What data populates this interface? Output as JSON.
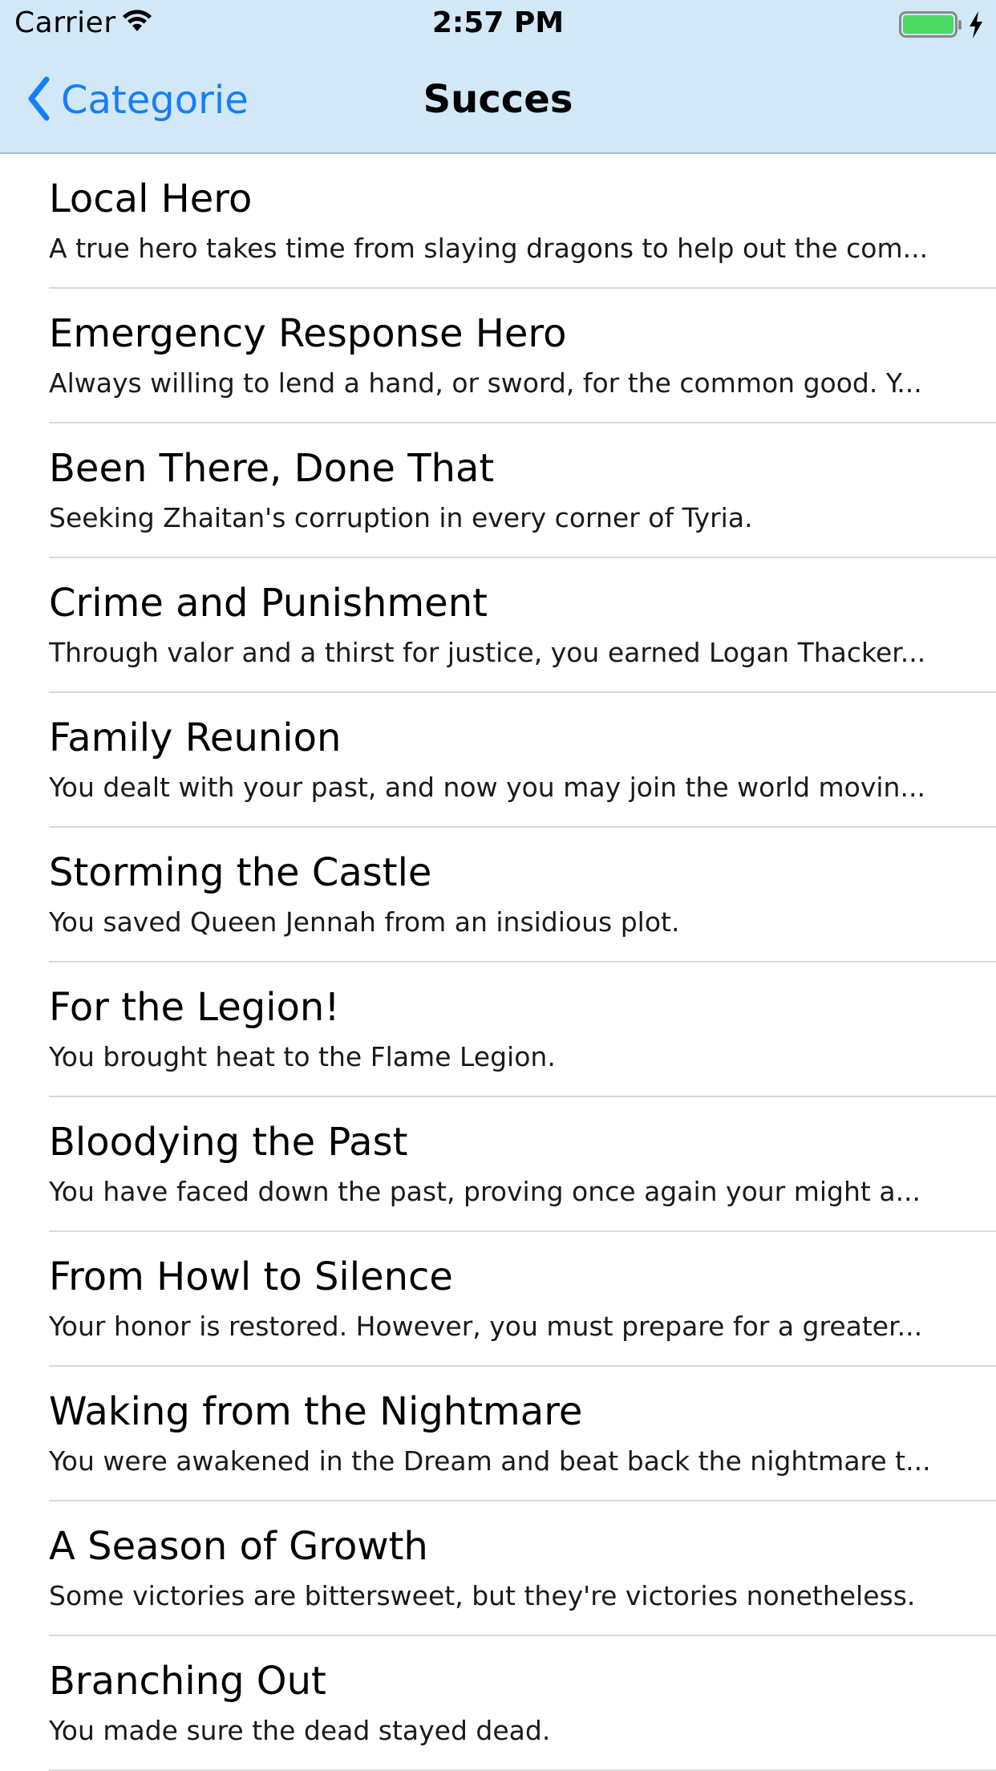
{
  "status_bar": {
    "carrier": "Carrier",
    "time": "2:57 PM",
    "battery_color": "#4cd964",
    "icons": [
      "wifi-icon",
      "battery-icon",
      "charging-bolt-icon"
    ]
  },
  "nav": {
    "back_label": "Categorie",
    "title": "Succes",
    "accent_color": "#157efb",
    "background_color": "#d3e8f6"
  },
  "items": [
    {
      "title": "Local Hero",
      "subtitle": "A true hero takes time from slaying dragons to help out the com..."
    },
    {
      "title": "Emergency Response Hero",
      "subtitle": "Always willing to lend a hand, or sword, for the common good. Y..."
    },
    {
      "title": "Been There, Done That",
      "subtitle": "Seeking Zhaitan's corruption in every corner of Tyria."
    },
    {
      "title": "Crime and Punishment",
      "subtitle": "Through valor and a thirst for justice, you earned Logan Thacker..."
    },
    {
      "title": "Family Reunion",
      "subtitle": "You dealt with your past, and now you may join the world movin..."
    },
    {
      "title": "Storming the Castle",
      "subtitle": "You saved Queen Jennah from an insidious plot."
    },
    {
      "title": "For the Legion!",
      "subtitle": "You brought heat to the Flame Legion."
    },
    {
      "title": "Bloodying the Past",
      "subtitle": "You have faced down the past, proving once again your might a..."
    },
    {
      "title": "From Howl to Silence",
      "subtitle": "Your honor is restored. However, you must prepare for a greater..."
    },
    {
      "title": "Waking from the Nightmare",
      "subtitle": "You were awakened in the Dream and beat back the nightmare t..."
    },
    {
      "title": "A Season of Growth",
      "subtitle": "Some victories are bittersweet, but they're victories nonetheless."
    },
    {
      "title": "Branching Out",
      "subtitle": "You made sure the dead stayed dead."
    }
  ]
}
